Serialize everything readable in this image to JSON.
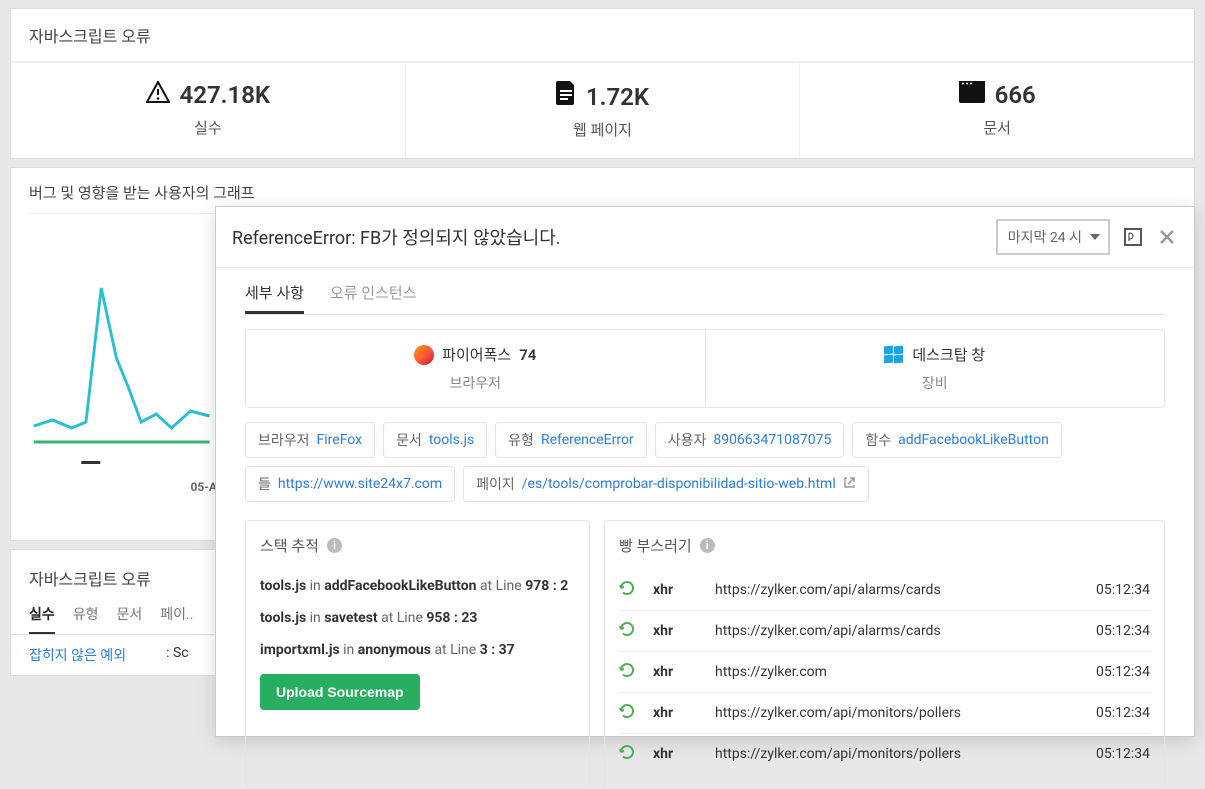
{
  "page_title": "자바스크립트 오류",
  "stats": [
    {
      "icon": "warning",
      "value": "427.18K",
      "label": "실수"
    },
    {
      "icon": "doc",
      "value": "1.72K",
      "label": "웹 페이지"
    },
    {
      "icon": "window",
      "value": "666",
      "label": "문서"
    }
  ],
  "graph": {
    "title": "버그 및 영향을 받는 사용자의 그래프",
    "xlabel": "05-A"
  },
  "bottom": {
    "title": "자바스크립트 오류",
    "tabs": [
      "실수",
      "유형",
      "문서",
      "페이.."
    ],
    "row1_a": "잡히지 않은 예외",
    "row1_b": ": Sc"
  },
  "panel": {
    "title": "ReferenceError: FB가 정의되지 않았습니다.",
    "time": "마지막 24 시",
    "tabs": [
      "세부 사항",
      "오류 인스턴스"
    ],
    "meta": {
      "browser_name": "파이어폭스",
      "browser_version": "74",
      "browser_label": "브라우저",
      "os_name": "데스크탑 창",
      "os_label": "장비"
    },
    "chips": [
      {
        "k": "브라우저",
        "v": "FireFox"
      },
      {
        "k": "문서",
        "v": "tools.js"
      },
      {
        "k": "유형",
        "v": "ReferenceError"
      },
      {
        "k": "사용자",
        "v": "890663471087075"
      },
      {
        "k": "함수",
        "v": "addFacebookLikeButton"
      },
      {
        "k": "들",
        "v": "https://www.site24x7.com"
      },
      {
        "k": "페이지",
        "v": "/es/tools/comprobar-disponibilidad-sitio-web.html",
        "ext": true
      }
    ],
    "stack": {
      "title": "스택 추적",
      "lines": [
        {
          "file": "tools.js",
          "in": "in",
          "fn": "addFacebookLikeButton",
          "at": "at Line",
          "pos": "978 : 2"
        },
        {
          "file": "tools.js",
          "in": "in",
          "fn": "savetest",
          "at": "at Line",
          "pos": "958 : 23"
        },
        {
          "file": "importxml.js",
          "in": "in",
          "fn": "anonymous",
          "at": "at Line",
          "pos": "3 : 37"
        }
      ],
      "button": "Upload Sourcemap"
    },
    "crumbs": {
      "title": "빵 부스러기",
      "rows": [
        {
          "type": "xhr",
          "url": "https://zylker.com/api/alarms/cards",
          "time": "05:12:34"
        },
        {
          "type": "xhr",
          "url": "https://zylker.com/api/alarms/cards",
          "time": "05:12:34"
        },
        {
          "type": "xhr",
          "url": "https://zylker.com",
          "time": "05:12:34"
        },
        {
          "type": "xhr",
          "url": "https://zylker.com/api/monitors/pollers",
          "time": "05:12:34"
        },
        {
          "type": "xhr",
          "url": "https://zylker.com/api/monitors/pollers",
          "time": "05:12:34"
        }
      ]
    }
  }
}
